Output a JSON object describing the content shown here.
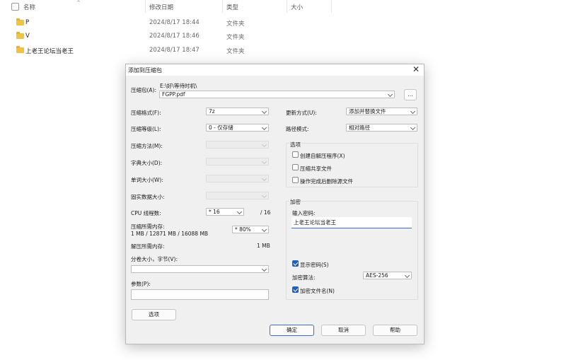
{
  "explorer": {
    "columns": {
      "name": "名称",
      "date": "修改日期",
      "type": "类型",
      "size": "大小"
    },
    "rows": [
      {
        "name": "P",
        "date": "2024/8/17 18:44",
        "type": "文件夹"
      },
      {
        "name": "V",
        "date": "2024/8/17 18:46",
        "type": "文件夹"
      },
      {
        "name": "上老王论坛当老王",
        "date": "2024/8/17 18:47",
        "type": "文件夹"
      }
    ]
  },
  "dialog": {
    "title": "添加到压缩包",
    "archive_label": "压缩包(A):",
    "archive_path": "E:\\好\\等待时机\\",
    "archive_file": "FGPP.pdf",
    "browse_label": "...",
    "format_label": "压缩格式(F):",
    "format_value": "7z",
    "level_label": "压缩等级(L):",
    "level_value": "0 - 仅存储",
    "method_label": "压缩方法(M):",
    "dict_label": "字典大小(D):",
    "word_label": "单词大小(W):",
    "solid_label": "固实数据大小:",
    "threads_label": "CPU 线程数:",
    "threads_value": "* 16",
    "threads_max": "/ 16",
    "mem_compress_label": "压缩所需内存:",
    "mem_compress_detail": "1 MB / 12871 MB / 16088 MB",
    "mem_percent": "* 80%",
    "mem_decompress_label": "解压所需内存:",
    "mem_decompress_value": "1 MB",
    "split_label": "分卷大小，字节(V):",
    "params_label": "参数(P):",
    "options_button": "选项",
    "update_label": "更新方式(U):",
    "update_value": "添加并替换文件",
    "pathmode_label": "路径模式:",
    "pathmode_value": "相对路径",
    "options_group": "选项",
    "opt_sfx": "创建自解压程序(X)",
    "opt_shared": "压缩共享文件",
    "opt_delete": "操作完成后删除源文件",
    "encrypt_group": "加密",
    "password_label": "输入密码:",
    "password_value": "上老王论坛当老王",
    "show_password": "显示密码(S)",
    "enc_method_label": "加密算法:",
    "enc_method_value": "AES-256",
    "enc_names": "加密文件名(N)",
    "ok": "确定",
    "cancel": "取消",
    "help": "帮助"
  },
  "colors": {
    "accent": "#1f5fbf",
    "folder": "#f4c242"
  }
}
